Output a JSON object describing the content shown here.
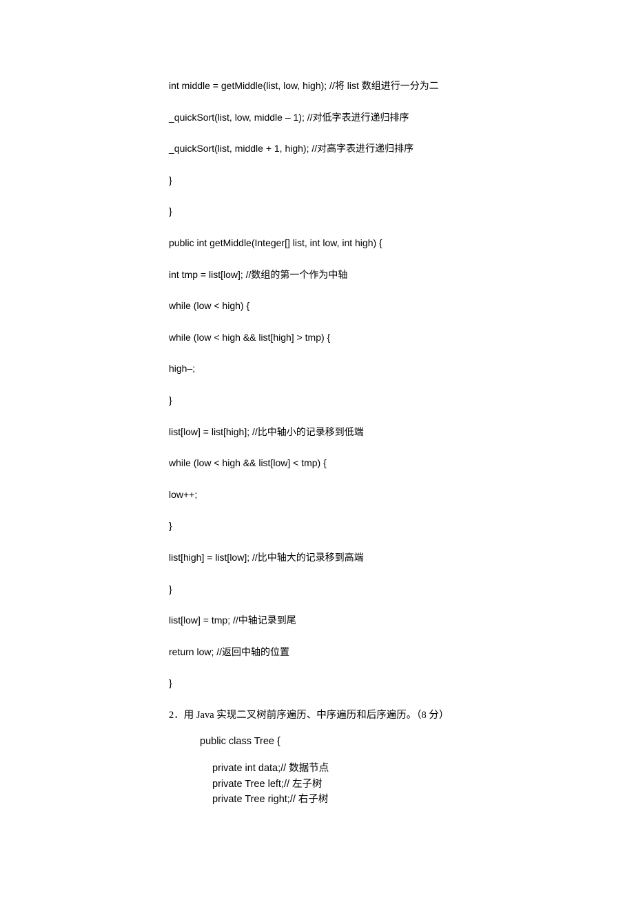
{
  "lines": {
    "l1": "int middle = getMiddle(list, low, high); //将 list 数组进行一分为二",
    "l2": "_quickSort(list, low, middle – 1); //对低字表进行递归排序",
    "l3": "_quickSort(list, middle + 1, high); //对高字表进行递归排序",
    "l4": "}",
    "l5": "}",
    "l6": "public int getMiddle(Integer[] list, int low, int high) {",
    "l7": "int tmp = list[low]; //数组的第一个作为中轴",
    "l8": "while (low < high) {",
    "l9": "while (low < high && list[high] > tmp) {",
    "l10": "high–;",
    "l11": "}",
    "l12": "list[low] = list[high]; //比中轴小的记录移到低端",
    "l13": "while (low < high && list[low] < tmp) {",
    "l14": "low++;",
    "l15": "}",
    "l16": "list[high] = list[low]; //比中轴大的记录移到高端",
    "l17": "}",
    "l18": "list[low] = tmp; //中轴记录到尾",
    "l19": "return low; //返回中轴的位置",
    "l20": "}"
  },
  "question": {
    "num": "2．",
    "text": "用 Java 实现二叉树前序遍历、中序遍历和后序遍历。（8 分）"
  },
  "classDecl": "public class Tree {",
  "fields": {
    "f1": "private int data;//  数据节点",
    "f2": "private Tree left;//  左子树",
    "f3": "private Tree right;//  右子树"
  }
}
